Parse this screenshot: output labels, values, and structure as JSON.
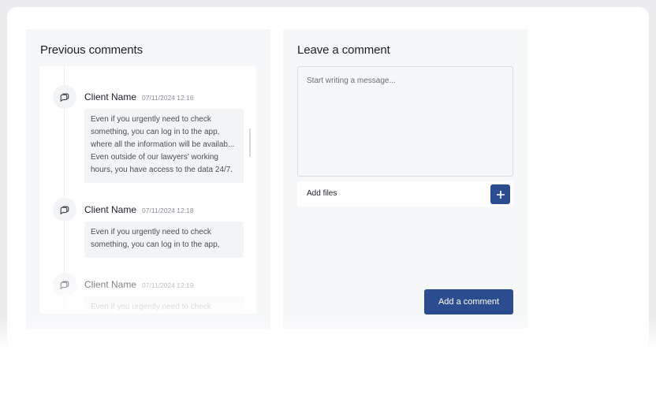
{
  "previous_comments": {
    "title": "Previous comments",
    "comments": [
      {
        "author": "Client Name",
        "date": "07/11/2024 12:16",
        "lines": [
          "Even if you urgently need to check",
          "something, you can log in to the app,",
          "where all the information will be availab...",
          "Even outside of our lawyers' working",
          "hours, you have access to the data 24/7."
        ]
      },
      {
        "author": "Client Name",
        "date": "07/11/2024 12:18",
        "lines": [
          "Even if you urgently need to check",
          "something, you can log in to the app,"
        ]
      },
      {
        "author": "Client Name",
        "date": "07/11/2024 12:19",
        "lines": [
          "Even if you urgently need to check"
        ]
      }
    ]
  },
  "leave_comment": {
    "title": "Leave a comment",
    "message_placeholder": "Start writing a message...",
    "add_files_label": "Add files",
    "submit_label": "Add a comment"
  },
  "colors": {
    "accent": "#2b4c8e",
    "panel_bg": "#f6f7f9"
  }
}
